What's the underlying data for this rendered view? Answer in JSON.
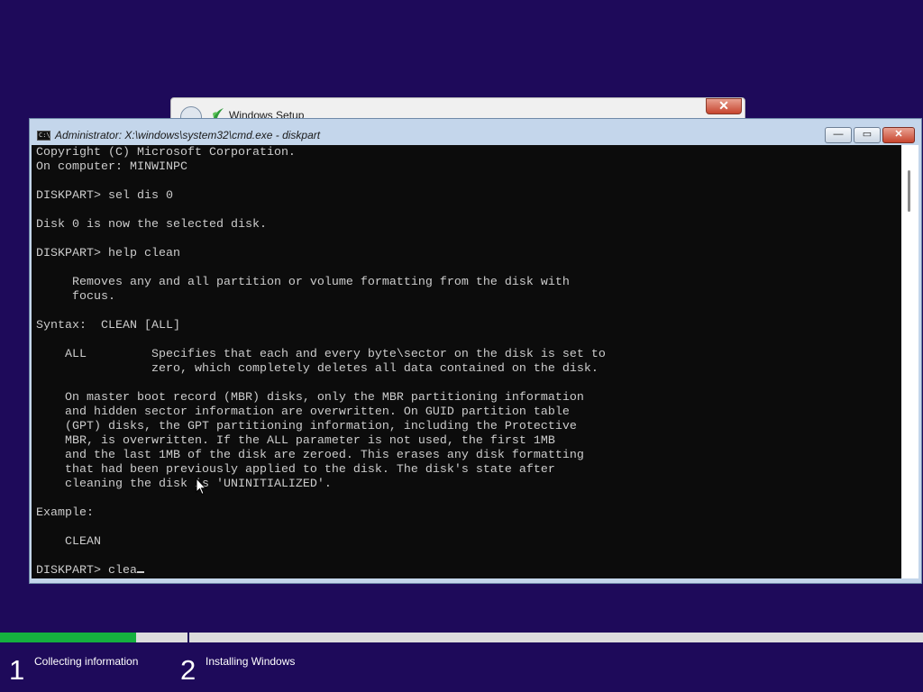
{
  "setup_window": {
    "title": "Windows Setup",
    "close_glyph": "✕"
  },
  "cmd_window": {
    "title": "Administrator: X:\\windows\\system32\\cmd.exe - diskpart",
    "icon_text": "C:\\",
    "buttons": {
      "minimize": "—",
      "maximize": "▭",
      "close": "✕"
    },
    "console_lines": "Copyright (C) Microsoft Corporation.\nOn computer: MINWINPC\n\nDISKPART> sel dis 0\n\nDisk 0 is now the selected disk.\n\nDISKPART> help clean\n\n     Removes any and all partition or volume formatting from the disk with\n     focus.\n\nSyntax:  CLEAN [ALL]\n\n    ALL         Specifies that each and every byte\\sector on the disk is set to\n                zero, which completely deletes all data contained on the disk.\n\n    On master boot record (MBR) disks, only the MBR partitioning information\n    and hidden sector information are overwritten. On GUID partition table\n    (GPT) disks, the GPT partitioning information, including the Protective\n    MBR, is overwritten. If the ALL parameter is not used, the first 1MB\n    and the last 1MB of the disk are zeroed. This erases any disk formatting\n    that had been previously applied to the disk. The disk's state after\n    cleaning the disk is 'UNINITIALIZED'.\n\nExample:\n\n    CLEAN\n\n",
    "prompt_line": "DISKPART> clea"
  },
  "progress": {
    "fraction": 0.147,
    "steps": [
      {
        "number": "1",
        "label": "Collecting information"
      },
      {
        "number": "2",
        "label": "Installing Windows"
      }
    ]
  },
  "colors": {
    "desktop": "#1e0a5a",
    "progress_fill": "#15b03f",
    "console_bg": "#0c0c0c",
    "console_text": "#cccccc"
  }
}
